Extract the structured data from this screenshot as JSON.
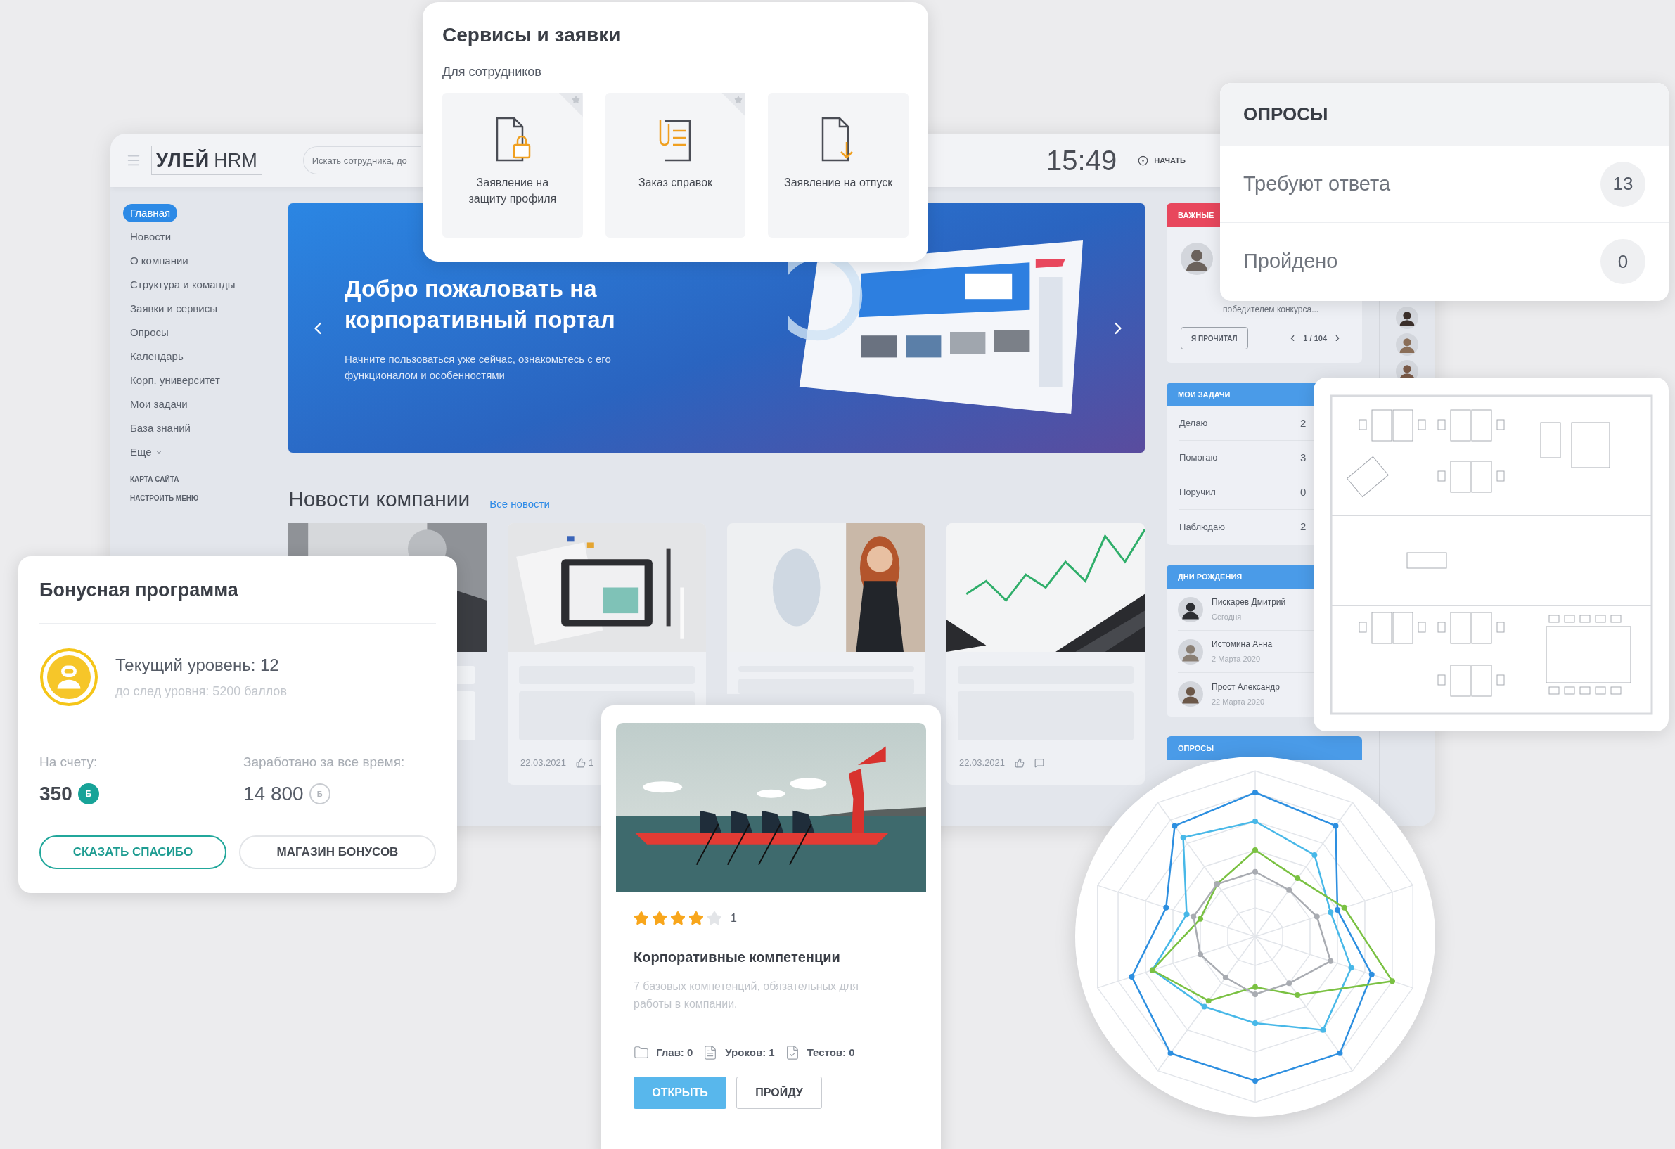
{
  "dashboard": {
    "logo": "УЛЕЙ",
    "logo_suffix": "HRM",
    "search": {
      "placeholder": "Искать сотрудника, до"
    },
    "time": "15:49",
    "start_label": "НАЧАТЬ",
    "sidebar": {
      "items": [
        {
          "label": "Главная",
          "selected": true
        },
        {
          "label": "Новости",
          "selected": false
        },
        {
          "label": "О компании",
          "selected": false
        },
        {
          "label": "Структура и команды",
          "selected": false
        },
        {
          "label": "Заявки и сервисы",
          "selected": false
        },
        {
          "label": "Опросы",
          "selected": false
        },
        {
          "label": "Календарь",
          "selected": false
        },
        {
          "label": "Корп. университет",
          "selected": false
        },
        {
          "label": "Мои задачи",
          "selected": false
        },
        {
          "label": "База знаний",
          "selected": false
        }
      ],
      "more": "Еще",
      "links": [
        "КАРТА САЙТА",
        "НАСТРОИТЬ МЕНЮ"
      ]
    },
    "banner": {
      "title": "Добро пожаловать на корпоративный портал",
      "subtitle": "Начните пользоваться уже сейчас, ознакомьтесь с его функционалом и особенностями"
    },
    "news": {
      "title": "Новости компании",
      "link": "Все новости",
      "cards": [
        {
          "kind": "picture"
        },
        {
          "kind": "picture",
          "date": "22.03.2021",
          "likes": "1"
        },
        {
          "kind": "picture"
        },
        {
          "kind": "picture",
          "date": "22.03.2021",
          "comments": true
        }
      ]
    },
    "important": {
      "title": "ВАЖНЫЕ",
      "snippet": "победителем конкурса...",
      "button": "Я ПРОЧИТАЛ",
      "pager": "1 / 104"
    },
    "tasks": {
      "title": "МОИ ЗАДАЧИ",
      "rows": [
        {
          "label": "Делаю",
          "count": "2"
        },
        {
          "label": "Помогаю",
          "count": "3"
        },
        {
          "label": "Поручил",
          "count": "0"
        },
        {
          "label": "Наблюдаю",
          "count": "2"
        }
      ]
    },
    "birthdays": {
      "title": "ДНИ РОЖДЕНИЯ",
      "people": [
        {
          "name": "Пискарев Дмитрий",
          "date": "Сегодня"
        },
        {
          "name": "Истомина Анна",
          "date": "2 Марта 2020"
        },
        {
          "name": "Прост Александр",
          "date": "22 Марта 2020"
        }
      ]
    },
    "polls_header": "ОПРОСЫ"
  },
  "services": {
    "title": "Сервисы и заявки",
    "subtitle": "Для сотрудников",
    "tiles": [
      {
        "label": "Заявление на защиту профиля",
        "kind": "lock",
        "starred": true
      },
      {
        "label": "Заказ справок",
        "kind": "clip",
        "starred": true
      },
      {
        "label": "Заявление на отпуск",
        "kind": "download",
        "starred": false
      }
    ]
  },
  "polls": {
    "title": "ОПРОСЫ",
    "rows": [
      {
        "label": "Требуют ответа",
        "count": "13"
      },
      {
        "label": "Пройдено",
        "count": "0"
      }
    ]
  },
  "bonus": {
    "title": "Бонусная программа",
    "level_text": "Текущий уровень: 12",
    "next_level": "до след уровня: 5200 баллов",
    "balance_label": "На счету:",
    "balance": "350",
    "currency": "Б",
    "earned_label": "Заработано за все время:",
    "earned": "14 800",
    "earned_currency": "Б",
    "buttons": [
      {
        "label": "СКАЗАТЬ СПАСИБО",
        "kind": "accent"
      },
      {
        "label": "МАГАЗИН БОНУСОВ",
        "kind": "plain"
      }
    ]
  },
  "course": {
    "stars": 4,
    "rating_count": "1",
    "title": "Корпоративные компетенции",
    "description": "7 базовых компетенций, обязательных для работы в компании.",
    "meta": [
      {
        "kind": "chapters",
        "text": "Глав: 0"
      },
      {
        "kind": "lessons",
        "text": "Уроков: 1"
      },
      {
        "kind": "tests",
        "text": "Тестов: 0"
      }
    ],
    "buttons": [
      {
        "label": "ОТКРЫТЬ",
        "kind": "primary"
      },
      {
        "label": "ПРОЙДУ",
        "kind": "secondary"
      }
    ]
  }
}
